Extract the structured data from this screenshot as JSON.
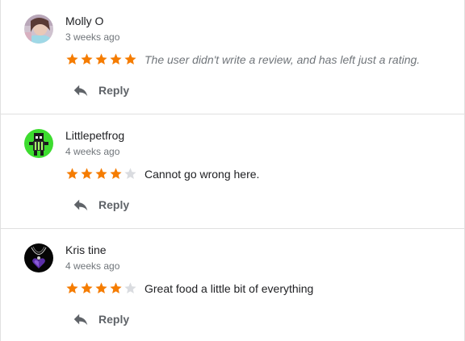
{
  "colors": {
    "star_filled": "#f57c00",
    "star_empty": "#dadce0",
    "divider": "#e0e0e0"
  },
  "reviews": [
    {
      "author": "Molly O",
      "date": "3 weeks ago",
      "rating": 5,
      "text": "The user didn't write a review, and has left just a rating.",
      "reply_label": "Reply"
    },
    {
      "author": "Littlepetfrog",
      "date": "4 weeks ago",
      "rating": 4,
      "text": "Cannot go wrong here.",
      "reply_label": "Reply"
    },
    {
      "author": "Kris tine",
      "date": "4 weeks ago",
      "rating": 4,
      "text": "Great food a little bit of everything",
      "reply_label": "Reply"
    }
  ],
  "icons": {
    "reply": "reply-icon",
    "star": "star-icon"
  }
}
